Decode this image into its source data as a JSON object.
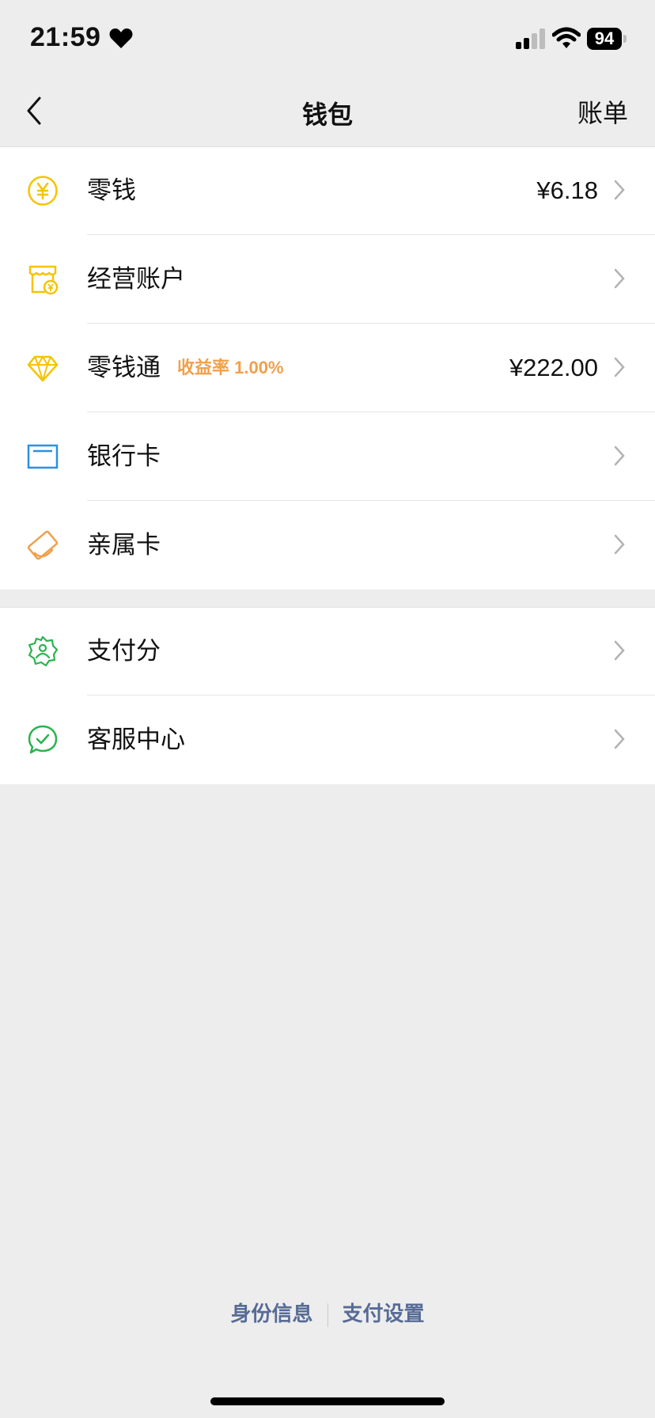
{
  "status": {
    "time": "21:59",
    "battery": "94"
  },
  "nav": {
    "title": "钱包",
    "bill": "账单"
  },
  "group1": [
    {
      "label": "零钱",
      "value": "¥6.18",
      "icon": "coin-yuan-icon"
    },
    {
      "label": "经营账户",
      "value": "",
      "icon": "shop-account-icon"
    },
    {
      "label": "零钱通",
      "tag": "收益率 1.00%",
      "value": "¥222.00",
      "icon": "diamond-icon"
    },
    {
      "label": "银行卡",
      "value": "",
      "icon": "bank-card-icon"
    },
    {
      "label": "亲属卡",
      "value": "",
      "icon": "family-card-icon"
    }
  ],
  "group2": [
    {
      "label": "支付分",
      "value": "",
      "icon": "pay-score-icon"
    },
    {
      "label": "客服中心",
      "value": "",
      "icon": "customer-service-icon"
    }
  ],
  "footer": {
    "identity": "身份信息",
    "pay_settings": "支付设置"
  },
  "colors": {
    "yellow": "#f5c400",
    "orange": "#f0a04b",
    "blue": "#2f8fe0",
    "green": "#2bb34f",
    "link": "#576b95"
  }
}
